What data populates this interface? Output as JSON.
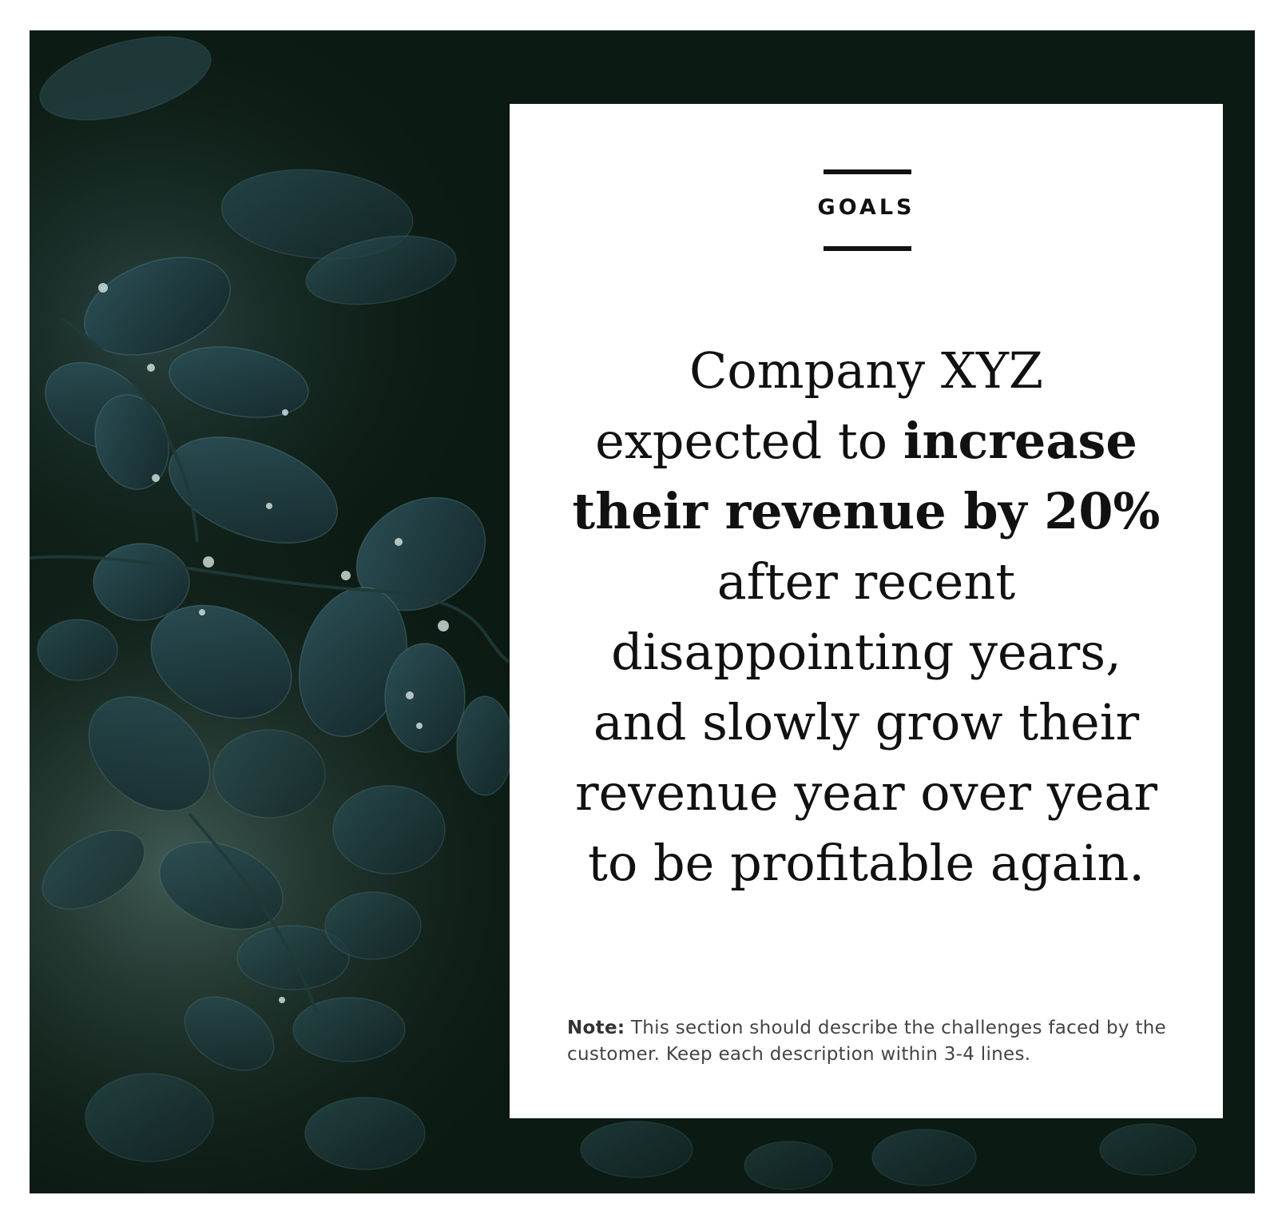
{
  "card": {
    "section_label": "GOALS",
    "headline_lines": [
      {
        "plain": "Company XYZ",
        "bold": ""
      },
      {
        "plain": "expected to ",
        "bold": "increase"
      },
      {
        "plain": "",
        "bold": "their revenue by 20%"
      },
      {
        "plain": "after recent",
        "bold": ""
      },
      {
        "plain": "disappointing years,",
        "bold": ""
      },
      {
        "plain": "and slowly grow their",
        "bold": ""
      },
      {
        "plain": "revenue year over year",
        "bold": ""
      },
      {
        "plain": "to be profitable again.",
        "bold": ""
      }
    ],
    "note_label": "Note:",
    "note_text": " This section should describe the challenges faced by the customer. Keep each description within 3-4 lines."
  },
  "colors": {
    "frame_background": "#0b1a12",
    "leaf_color": "#1d3a3e",
    "card_background": "#ffffff",
    "text": "#111111"
  }
}
